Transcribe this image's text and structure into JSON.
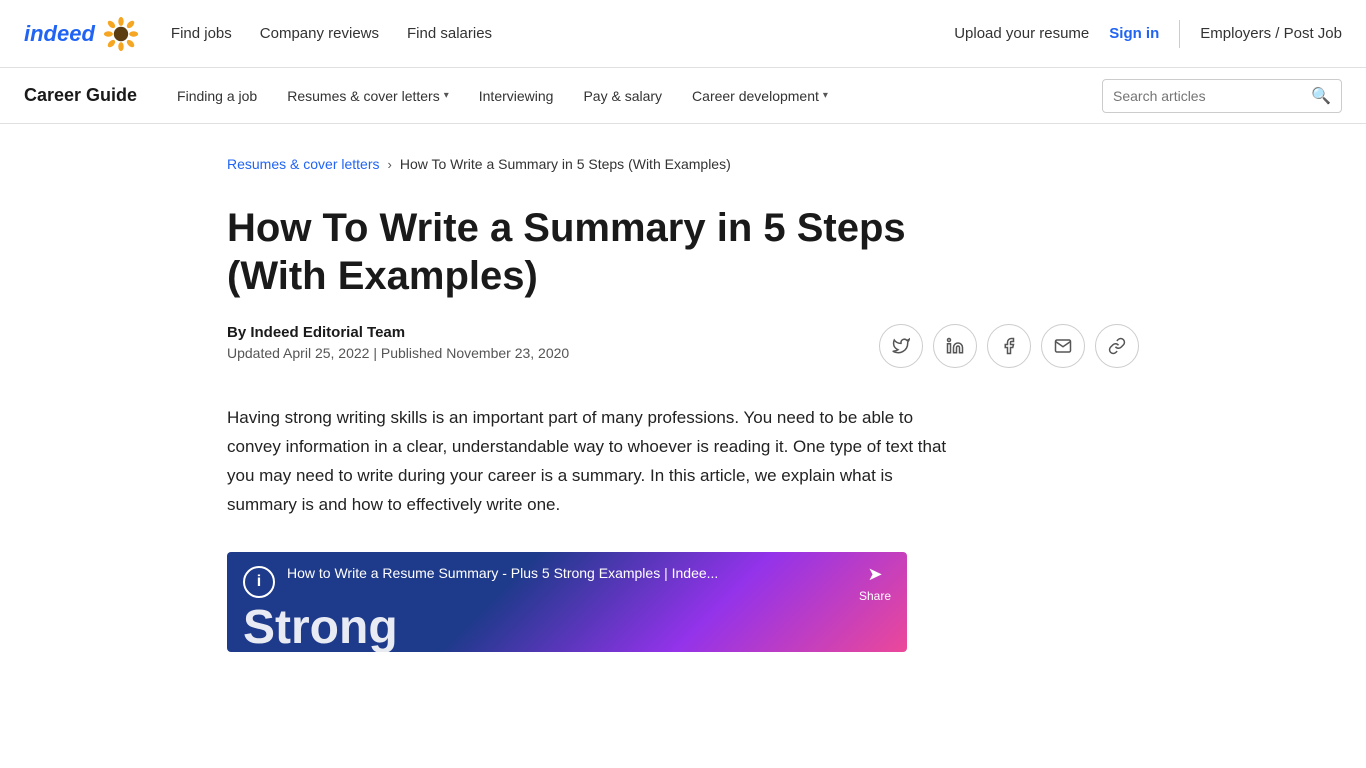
{
  "topnav": {
    "logo_text": "indeed",
    "find_jobs": "Find jobs",
    "company_reviews": "Company reviews",
    "find_salaries": "Find salaries",
    "upload_resume": "Upload your resume",
    "sign_in": "Sign in",
    "employers": "Employers / Post Job"
  },
  "careernav": {
    "title": "Career Guide",
    "finding_a_job": "Finding a job",
    "resumes": "Resumes & cover letters",
    "interviewing": "Interviewing",
    "pay_salary": "Pay & salary",
    "career_dev": "Career development",
    "search_placeholder": "Search articles"
  },
  "breadcrumb": {
    "link_text": "Resumes & cover letters",
    "separator": "›",
    "current": "How To Write a Summary in 5 Steps (With Examples)"
  },
  "article": {
    "title": "How To Write a Summary in 5 Steps (With Examples)",
    "author": "By Indeed Editorial Team",
    "dates": "Updated April 25, 2022 | Published November 23, 2020",
    "intro": "Having strong writing skills is an important part of many professions. You need to be able to convey information in a clear, understandable way to whoever is reading it. One type of text that you may need to write during your career is a summary. In this article, we explain what is summary is and how to effectively write one.",
    "video_title": "How to Write a Resume Summary - Plus 5 Strong Examples | Indee...",
    "video_share": "Share",
    "video_strong": "Strong"
  }
}
